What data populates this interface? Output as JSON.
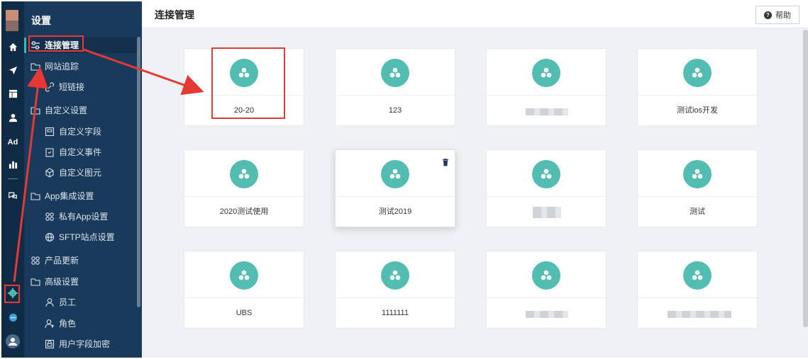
{
  "sidebar": {
    "title": "设置",
    "items": [
      {
        "label": "连接管理",
        "icon": "sliders-icon",
        "active": true
      },
      {
        "label": "网站追踪",
        "icon": "folder-icon"
      },
      {
        "label": "短链接",
        "icon": "link-icon"
      },
      {
        "label": "自定义设置",
        "icon": "folder-icon"
      },
      {
        "label": "自定义字段",
        "icon": "field-icon"
      },
      {
        "label": "自定义事件",
        "icon": "event-icon"
      },
      {
        "label": "自定义图元",
        "icon": "cube-icon"
      },
      {
        "label": "App集成设置",
        "icon": "folder-icon"
      },
      {
        "label": "私有App设置",
        "icon": "grid-icon"
      },
      {
        "label": "SFTP站点设置",
        "icon": "globe-icon"
      },
      {
        "label": "产品更新",
        "icon": "grid-icon"
      },
      {
        "label": "高级设置",
        "icon": "folder-icon"
      },
      {
        "label": "员工",
        "icon": "user-icon"
      },
      {
        "label": "角色",
        "icon": "role-icon"
      },
      {
        "label": "用户字段加密",
        "icon": "encrypt-icon"
      }
    ]
  },
  "rail": {
    "icons": [
      "home-icon",
      "send-icon",
      "table-icon",
      "person-icon",
      "ad-icon",
      "bar-chart-icon",
      "chat-icon",
      "gear-icon",
      "message-icon",
      "user-avatar-icon"
    ],
    "ad_text": "Ad"
  },
  "header": {
    "title": "连接管理",
    "help_label": "帮助"
  },
  "connections": [
    {
      "name": "20-20"
    },
    {
      "name": "123"
    },
    {
      "name": ""
    },
    {
      "name": "测试ios开发"
    },
    {
      "name": "2020测试使用"
    },
    {
      "name": "测试2019"
    },
    {
      "name": ""
    },
    {
      "name": "测试"
    },
    {
      "name": "UBS"
    },
    {
      "name": "1111111"
    },
    {
      "name": ""
    },
    {
      "name": ""
    }
  ],
  "colors": {
    "accent": "#52bdb0",
    "sidebar": "#1a3a5c",
    "rail": "#0f2b45",
    "annotation": "#e53935"
  }
}
